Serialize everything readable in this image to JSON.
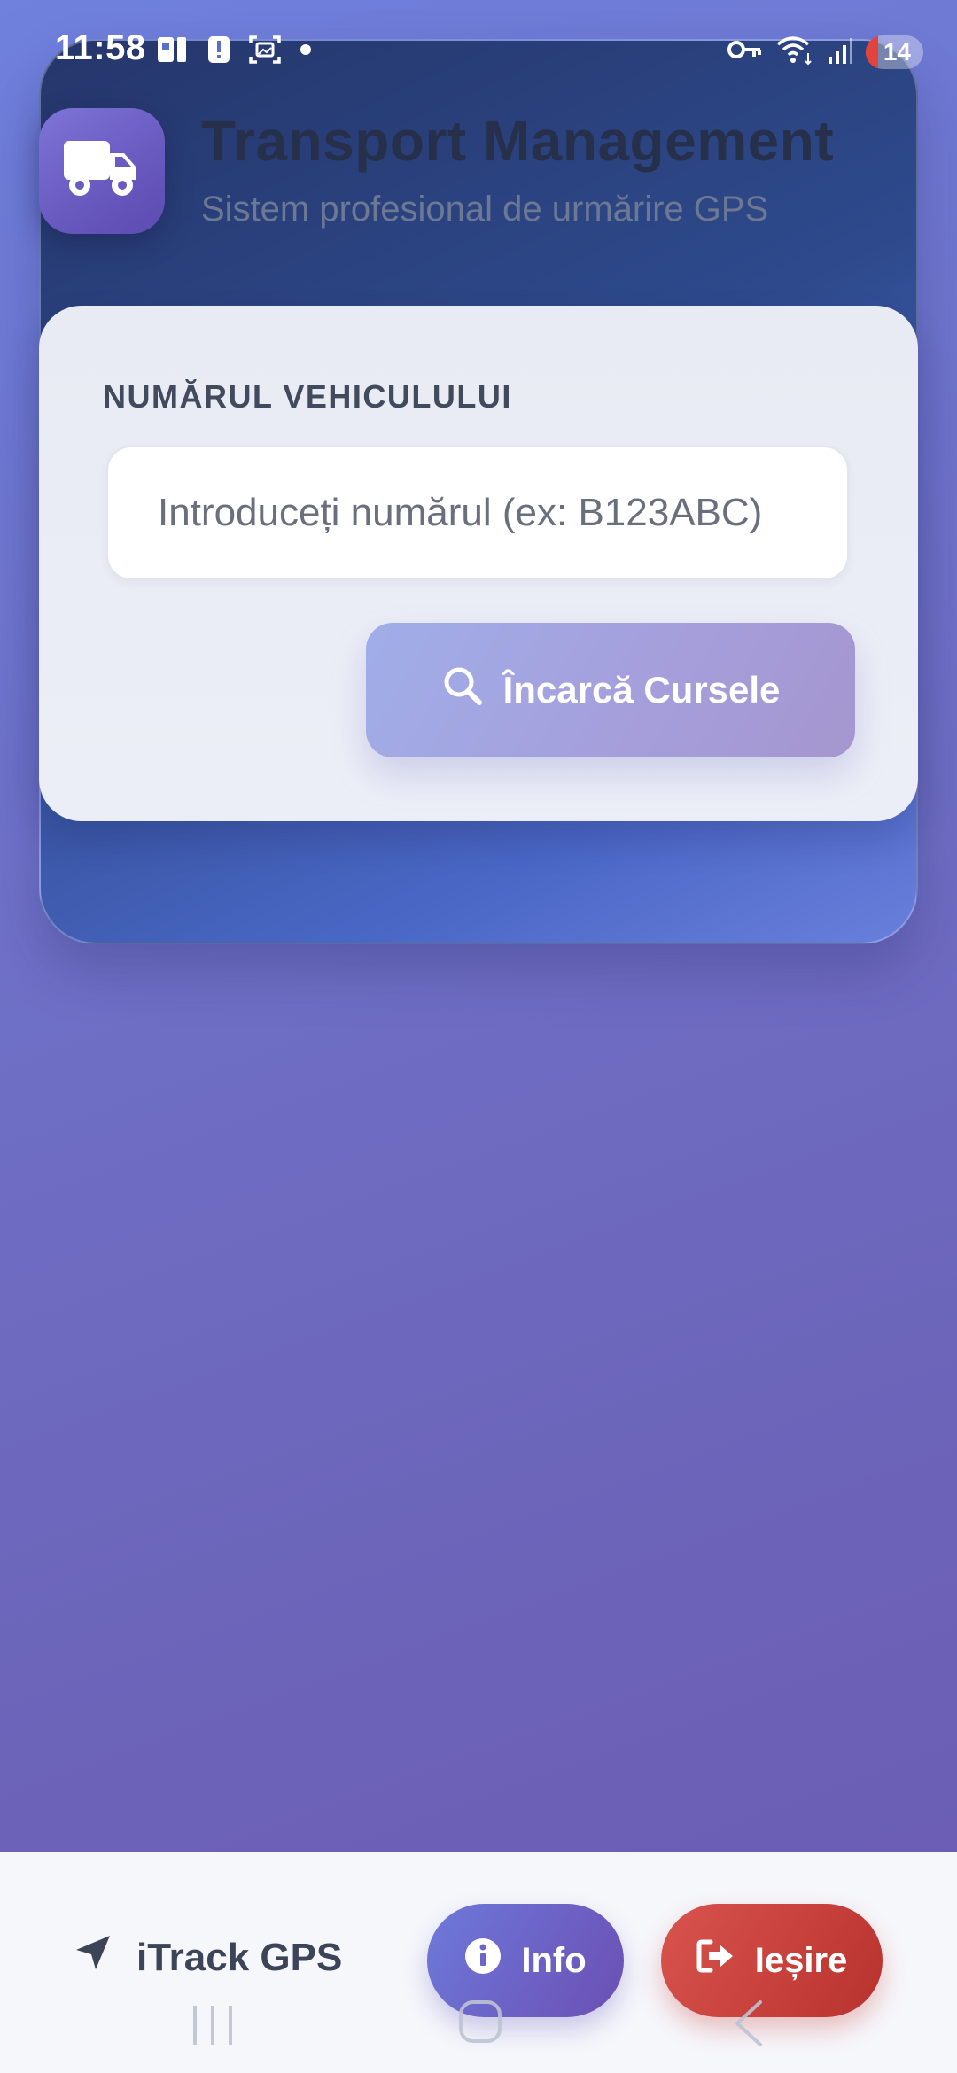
{
  "status_bar": {
    "time": "11:58",
    "battery": "14",
    "icons": [
      "sim-card-icon",
      "alert-icon",
      "screenshot-icon",
      "dot-icon",
      "vpn-key-icon",
      "wifi-icon",
      "signal-icon",
      "battery-icon"
    ]
  },
  "header": {
    "title": "Transport Management",
    "subtitle": "Sistem profesional de urmărire GPS",
    "logo_icon": "truck-icon"
  },
  "form": {
    "label": "NUMĂRUL VEHICULULUI",
    "input_value": "",
    "input_placeholder": "Introduceți numărul (ex: B123ABC)",
    "button_label": "Încarcă Cursele",
    "button_icon": "search-icon"
  },
  "bottom_bar": {
    "brand_label": "iTrack GPS",
    "brand_icon": "location-arrow-icon",
    "info_label": "Info",
    "info_icon": "info-icon",
    "exit_label": "Ieșire",
    "exit_icon": "sign-out-icon"
  },
  "colors": {
    "primary": "#6d62c4",
    "danger": "#c63f3a",
    "card_dark": "#2e4a8c",
    "background": "#6f72c9"
  }
}
